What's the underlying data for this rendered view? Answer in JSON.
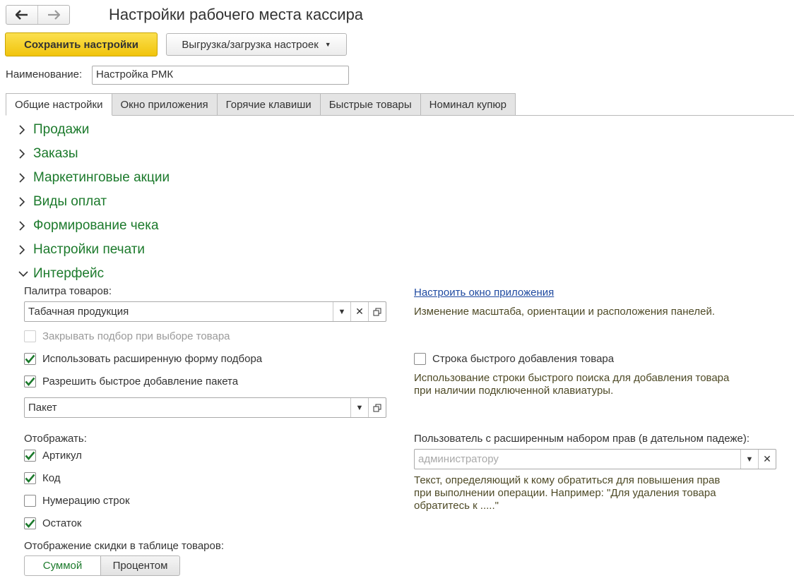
{
  "window": {
    "title": "Настройки рабочего места кассира"
  },
  "nav": {
    "back_icon": "arrow-left-icon",
    "forward_icon": "arrow-right-icon"
  },
  "toolbar": {
    "save_label": "Сохранить настройки",
    "export_label": "Выгрузка/загрузка настроек"
  },
  "name_field": {
    "label": "Наименование:",
    "value": "Настройка РМК"
  },
  "tabs": [
    {
      "label": "Общие настройки",
      "active": true
    },
    {
      "label": "Окно приложения"
    },
    {
      "label": "Горячие клавиши"
    },
    {
      "label": "Быстрые товары"
    },
    {
      "label": "Номинал купюр"
    }
  ],
  "sections": [
    {
      "label": "Продажи",
      "expanded": false
    },
    {
      "label": "Заказы",
      "expanded": false
    },
    {
      "label": "Маркетинговые акции",
      "expanded": false
    },
    {
      "label": "Виды оплат",
      "expanded": false
    },
    {
      "label": "Формирование чека",
      "expanded": false
    },
    {
      "label": "Настройки печати",
      "expanded": false
    },
    {
      "label": "Интерфейс",
      "expanded": true
    }
  ],
  "interface": {
    "palette_label": "Палитра товаров:",
    "palette_value": "Табачная продукция",
    "close_pick": {
      "label": "Закрывать подбор при выборе товара",
      "checked": false,
      "disabled": true
    },
    "extended_form": {
      "label": "Использовать расширенную форму подбора",
      "checked": true
    },
    "quick_package": {
      "label": "Разрешить быстрое добавление пакета",
      "checked": true
    },
    "package_value": "Пакет",
    "display_label": "Отображать:",
    "display_items": [
      {
        "label": "Артикул",
        "checked": true
      },
      {
        "label": "Код",
        "checked": true
      },
      {
        "label": "Нумерацию строк",
        "checked": false
      },
      {
        "label": "Остаток",
        "checked": true
      }
    ],
    "discount_label": "Отображение скидки в таблице товаров:",
    "discount_options": [
      "Суммой",
      "Процентом"
    ],
    "discount_selected": "Суммой",
    "configure_link": "Настроить окно приложения",
    "configure_hint": "Изменение масштаба, ориентации и расположения панелей.",
    "quick_add_row": {
      "label": "Строка быстрого добавления товара",
      "checked": false
    },
    "quick_add_hint_1": "Использование строки быстрого поиска для добавления товара",
    "quick_add_hint_2": "при наличии подключенной клавиатуры.",
    "rights_label": "Пользователь с расширенным набором прав (в дательном падеже):",
    "rights_placeholder": "администратору",
    "rights_hint_1": "Текст, определяющий к кому обратиться для повышения прав",
    "rights_hint_2": "при выполнении операции. Например: \"Для удаления товара",
    "rights_hint_3": "обратитесь к .....\""
  },
  "colors": {
    "accent_green": "#1c7a2c",
    "primary_button": "#f1c40c",
    "link": "#1f4aa0"
  }
}
